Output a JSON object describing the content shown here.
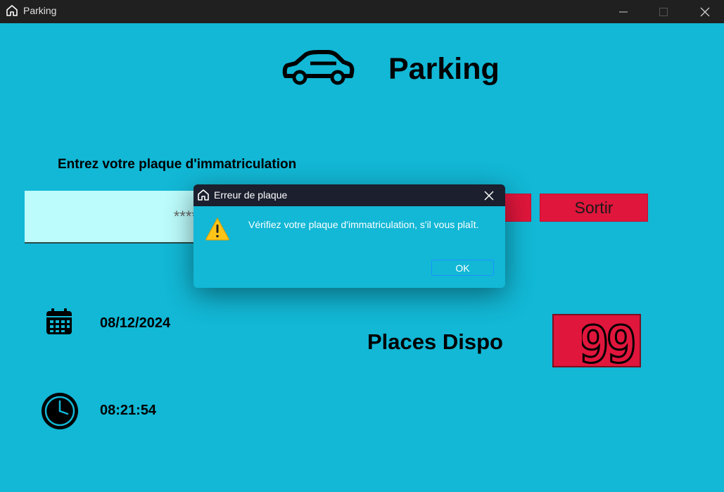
{
  "window": {
    "title": "Parking"
  },
  "header": {
    "title": "Parking"
  },
  "plate": {
    "label": "Entrez votre plaque d'immatriculation",
    "value": "****"
  },
  "buttons": {
    "exit_label": "Sortir"
  },
  "date": "08/12/2024",
  "time": "08:21:54",
  "places": {
    "label": "Places Dispo",
    "count": "99"
  },
  "dialog": {
    "title": "Erreur de plaque",
    "message": "Vérifiez votre plaque d'immatriculation, s'il vous plaît.",
    "ok_label": "OK"
  },
  "colors": {
    "background": "#12b8d6",
    "accent_red": "#e0163c",
    "titlebar": "#202020"
  }
}
